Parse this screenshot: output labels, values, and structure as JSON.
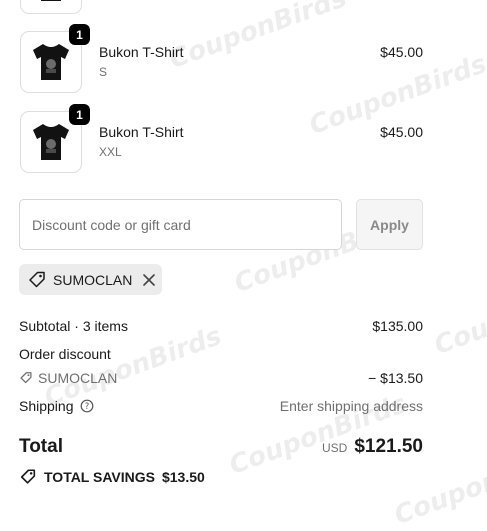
{
  "line_items": [
    {
      "name": "Bukon T-Shirt",
      "variant": "S",
      "price": "$45.00",
      "quantity": "1"
    },
    {
      "name": "Bukon T-Shirt",
      "variant": "XXL",
      "price": "$45.00",
      "quantity": "1"
    }
  ],
  "discount": {
    "placeholder": "Discount code or gift card",
    "apply_label": "Apply",
    "applied_code": "SUMOCLAN"
  },
  "summary": {
    "subtotal_label": "Subtotal · 3 items",
    "subtotal_value": "$135.00",
    "order_discount_label": "Order discount",
    "order_discount_code": "SUMOCLAN",
    "order_discount_value": "− $13.50",
    "shipping_label": "Shipping",
    "shipping_value": "Enter shipping address",
    "total_label": "Total",
    "total_currency": "USD",
    "total_value": "$121.50",
    "savings_label": "TOTAL SAVINGS",
    "savings_value": "$13.50"
  },
  "watermark": "CouponBirds"
}
